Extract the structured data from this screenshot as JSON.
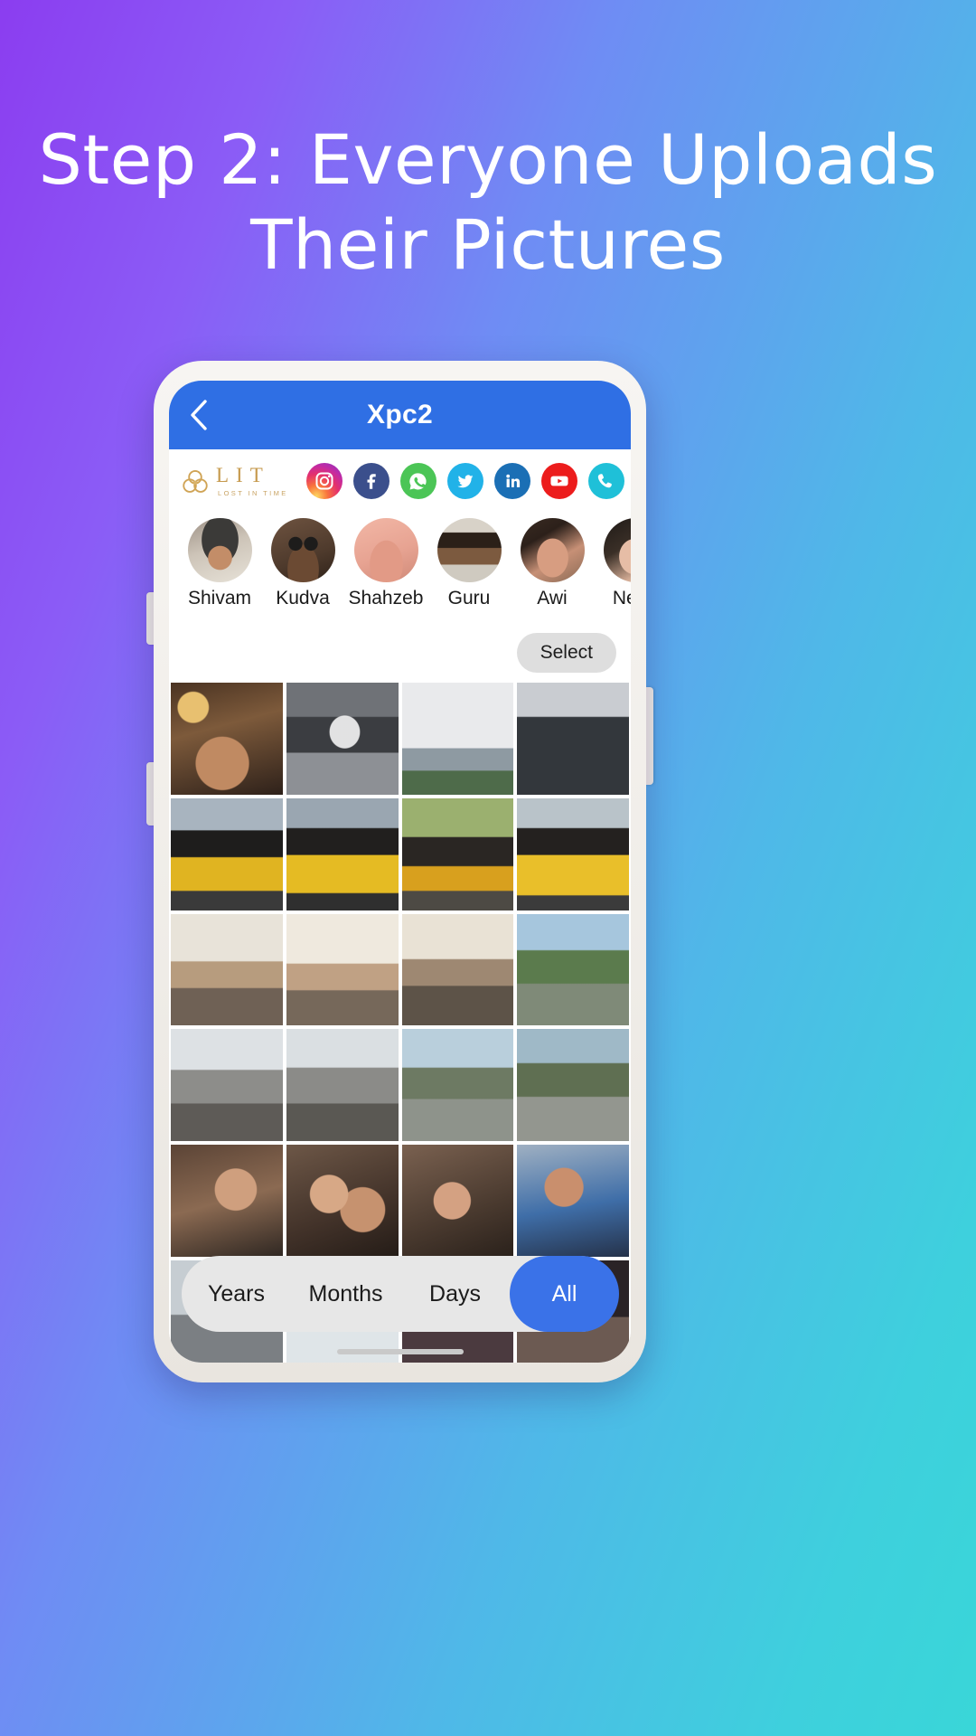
{
  "promo": {
    "headline_line1": "Step 2: Everyone Uploads",
    "headline_line2": "Their Pictures",
    "background_start": "#8b3df0",
    "background_end": "#39d6d8"
  },
  "app": {
    "appbar": {
      "title": "Xpc2",
      "back_icon": "chevron-left-icon",
      "bar_color": "#2f6fe4"
    },
    "brand": {
      "name": "LIT",
      "tagline": "LOST IN TIME",
      "color": "#c69a4e"
    },
    "social_icons": [
      {
        "name": "instagram-icon",
        "label": "Instagram",
        "color": "#e4306c"
      },
      {
        "name": "facebook-icon",
        "label": "Facebook",
        "color": "#3b4f8c"
      },
      {
        "name": "whatsapp-icon",
        "label": "WhatsApp",
        "color": "#4bc556"
      },
      {
        "name": "twitter-icon",
        "label": "Twitter",
        "color": "#21b2e8"
      },
      {
        "name": "linkedin-icon",
        "label": "LinkedIn",
        "color": "#1b6fb5"
      },
      {
        "name": "youtube-icon",
        "label": "YouTube",
        "color": "#ec1c1c"
      },
      {
        "name": "phone-icon",
        "label": "Phone",
        "color": "#1fc0d8"
      }
    ],
    "overflow_menu": "more-options-icon",
    "members": [
      {
        "name": "Shivam"
      },
      {
        "name": "Kudva"
      },
      {
        "name": "Shahzeb"
      },
      {
        "name": "Guru"
      },
      {
        "name": "Awi"
      },
      {
        "name": "Neha"
      }
    ],
    "select_label": "Select",
    "fabs": [
      {
        "name": "delete-fab",
        "icon": "trash-icon",
        "color": "#3a72e8"
      },
      {
        "name": "add-fab",
        "icon": "plus-icon",
        "color": "#3a72e8"
      },
      {
        "name": "search-fab",
        "icon": "search-icon",
        "color": "#3a72e8"
      },
      {
        "name": "share-fab",
        "icon": "share-icon",
        "color": "#3a72e8"
      }
    ],
    "filters": [
      {
        "label": "Years",
        "active": false
      },
      {
        "label": "Months",
        "active": false
      },
      {
        "label": "Days",
        "active": false
      },
      {
        "label": "All",
        "active": true
      }
    ],
    "filter_active_color": "#3a72e8",
    "photo_count": 24
  }
}
